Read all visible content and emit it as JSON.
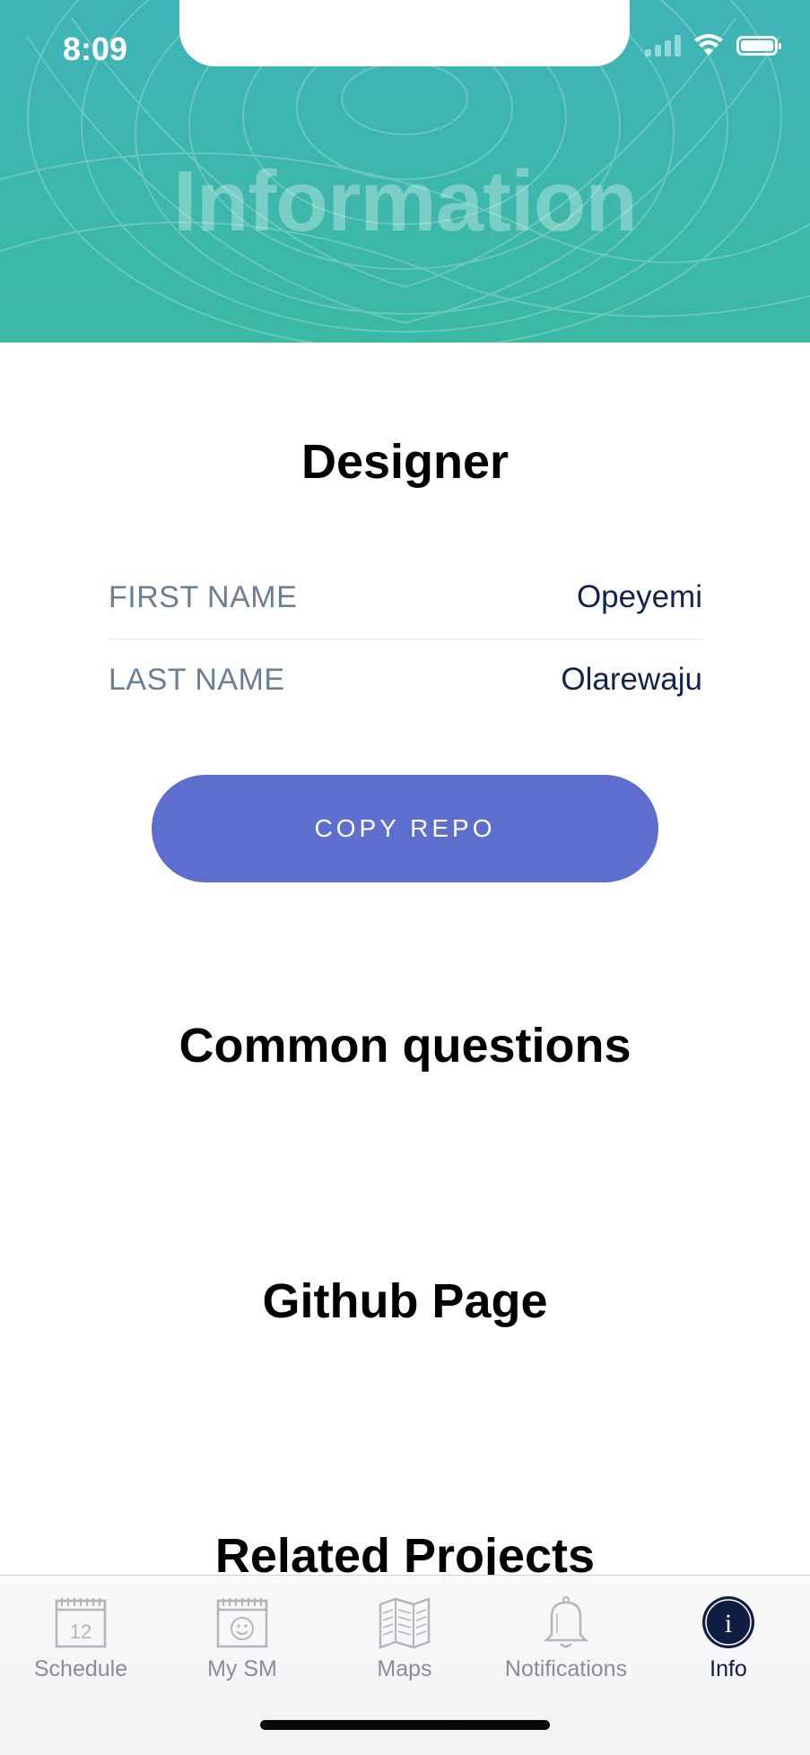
{
  "status_bar": {
    "time": "8:09"
  },
  "header": {
    "title": "Information"
  },
  "designer": {
    "title": "Designer",
    "fields": [
      {
        "label": "FIRST NAME",
        "value": "Opeyemi"
      },
      {
        "label": "LAST NAME",
        "value": "Olarewaju"
      }
    ],
    "copy_button_label": "COPY REPO"
  },
  "sections": {
    "common_questions": "Common questions",
    "github_page": "Github Page",
    "related_projects": "Related Projects"
  },
  "tabbar": {
    "items": [
      {
        "label": "Schedule",
        "icon": "calendar-icon",
        "calendar_number": "12"
      },
      {
        "label": "My SM",
        "icon": "smiley-calendar-icon"
      },
      {
        "label": "Maps",
        "icon": "map-icon"
      },
      {
        "label": "Notifications",
        "icon": "bell-icon"
      },
      {
        "label": "Info",
        "icon": "info-icon",
        "icon_glyph": "i",
        "active": true
      }
    ]
  },
  "colors": {
    "header_gradient_top": "#3fb4b7",
    "header_gradient_bottom": "#3bb9a2",
    "button": "#5d6ecf",
    "value_text": "#13234a",
    "label_text": "#6b7e94",
    "tab_active": "#0f1d45",
    "tab_inactive": "#8a8e94"
  }
}
